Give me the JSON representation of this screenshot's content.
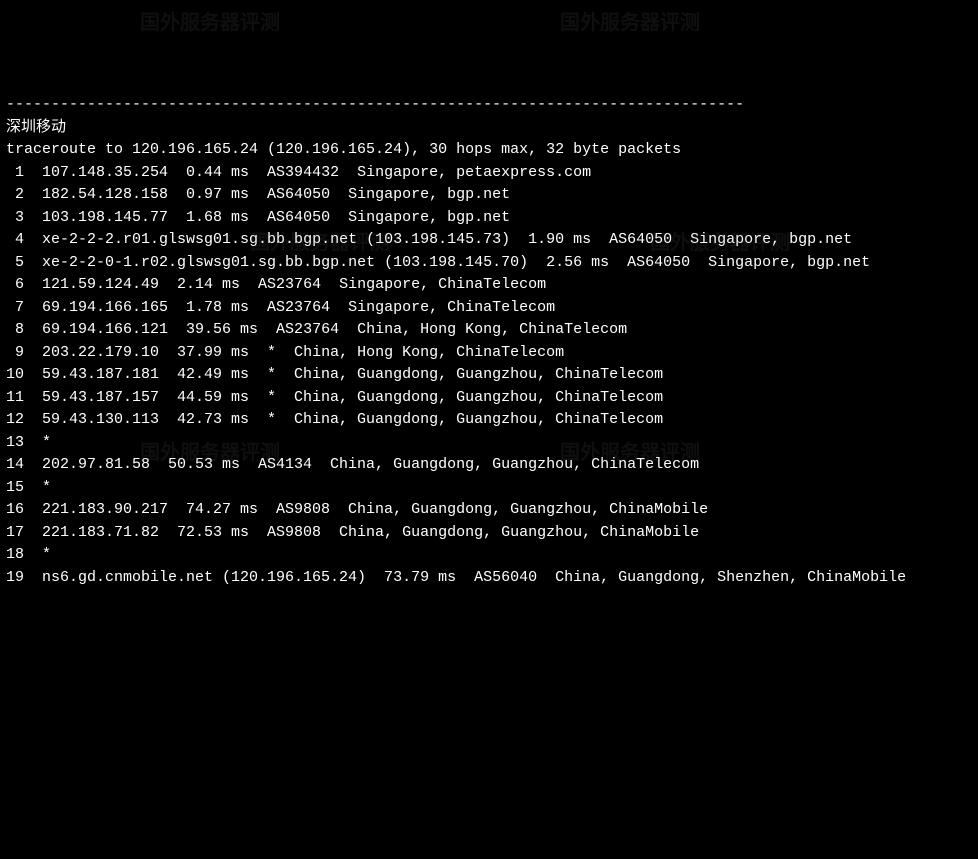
{
  "title_cn": "深圳移动",
  "dash_separator": "----------------------------------------------------------------------------------",
  "header_line": "traceroute to 120.196.165.24 (120.196.165.24), 30 hops max, 32 byte packets",
  "lines": [
    " 1  107.148.35.254  0.44 ms  AS394432  Singapore, petaexpress.com",
    " 2  182.54.128.158  0.97 ms  AS64050  Singapore, bgp.net",
    " 3  103.198.145.77  1.68 ms  AS64050  Singapore, bgp.net",
    " 4  xe-2-2-2.r01.glswsg01.sg.bb.bgp.net (103.198.145.73)  1.90 ms  AS64050  Singapore, bgp.net",
    " 5  xe-2-2-0-1.r02.glswsg01.sg.bb.bgp.net (103.198.145.70)  2.56 ms  AS64050  Singapore, bgp.net",
    " 6  121.59.124.49  2.14 ms  AS23764  Singapore, ChinaTelecom",
    " 7  69.194.166.165  1.78 ms  AS23764  Singapore, ChinaTelecom",
    " 8  69.194.166.121  39.56 ms  AS23764  China, Hong Kong, ChinaTelecom",
    " 9  203.22.179.10  37.99 ms  *  China, Hong Kong, ChinaTelecom",
    "10  59.43.187.181  42.49 ms  *  China, Guangdong, Guangzhou, ChinaTelecom",
    "11  59.43.187.157  44.59 ms  *  China, Guangdong, Guangzhou, ChinaTelecom",
    "12  59.43.130.113  42.73 ms  *  China, Guangdong, Guangzhou, ChinaTelecom",
    "13  *",
    "14  202.97.81.58  50.53 ms  AS4134  China, Guangdong, Guangzhou, ChinaTelecom",
    "15  *",
    "16  221.183.90.217  74.27 ms  AS9808  China, Guangdong, Guangzhou, ChinaMobile",
    "17  221.183.71.82  72.53 ms  AS9808  China, Guangdong, Guangzhou, ChinaMobile",
    "18  *",
    "19  ns6.gd.cnmobile.net (120.196.165.24)  73.79 ms  AS56040  China, Guangdong, Shenzhen, ChinaMobile"
  ],
  "watermark_text": "国外服务器评测"
}
